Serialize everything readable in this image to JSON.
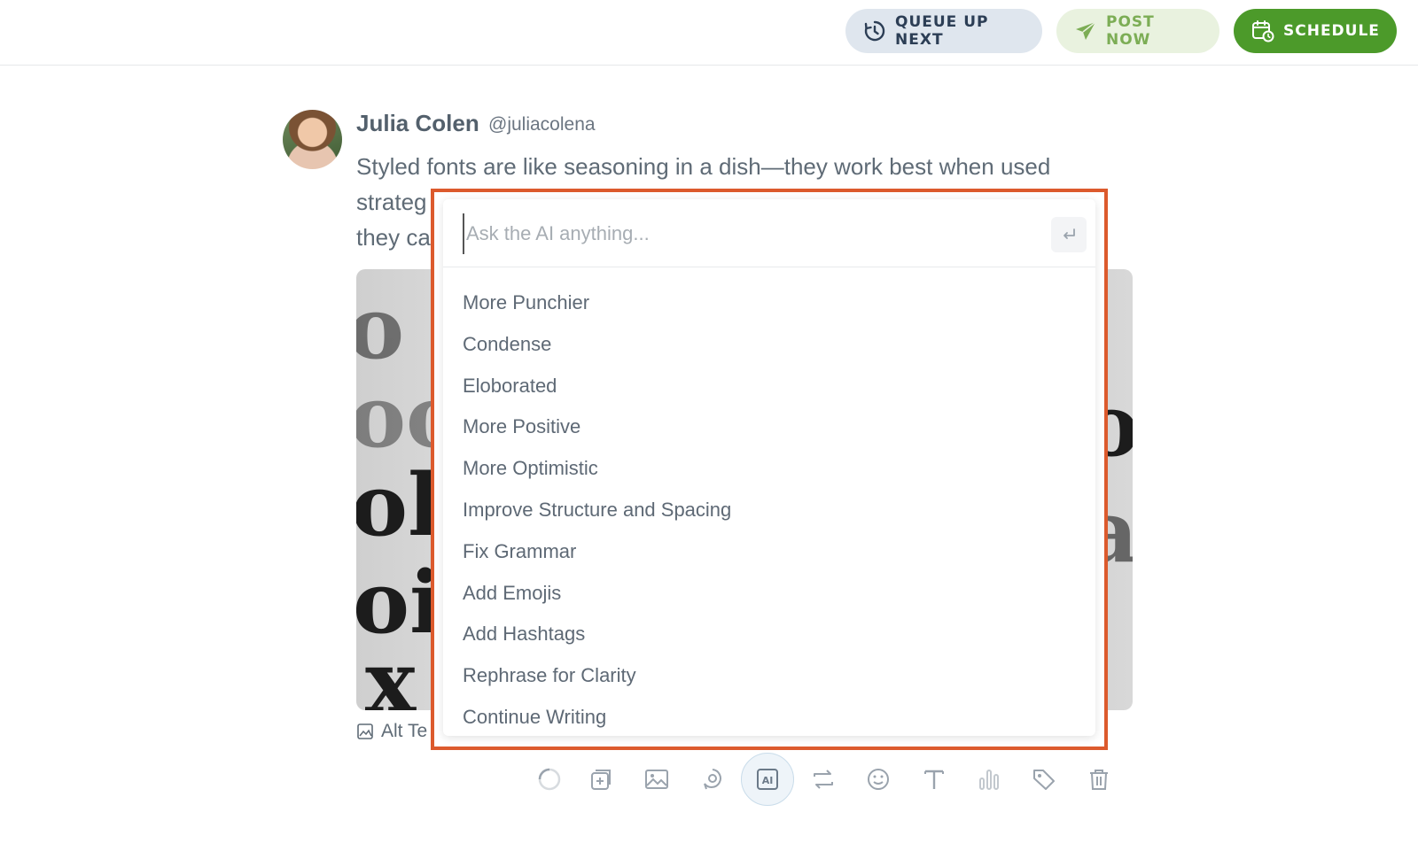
{
  "header": {
    "queue_label": "QUEUE UP NEXT",
    "post_label": "POST NOW",
    "schedule_label": "SCHEDULE"
  },
  "post": {
    "author_name": "Julia Colen",
    "author_handle": "@juliacolena",
    "text": "Styled fonts are like seasoning in a dish—they work best when used\nstrateg                                                                    ts,\nthey ca                                                                      e.",
    "alt_text_label": "Alt Te"
  },
  "ai_popup": {
    "placeholder": "Ask the AI anything...",
    "options": [
      "More Punchier",
      "Condense",
      "Eloborated",
      "More Positive",
      "More Optimistic",
      "Improve Structure and Spacing",
      "Fix Grammar",
      "Add Emojis",
      "Add Hashtags",
      "Rephrase for Clarity",
      "Continue Writing"
    ]
  },
  "toolbar": {
    "tools": [
      "loading-icon",
      "add-thread-icon",
      "image-icon",
      "gif-icon",
      "ai-icon",
      "repost-icon",
      "emoji-icon",
      "text-style-icon",
      "poll-icon",
      "tag-icon",
      "trash-icon"
    ],
    "ai_label": "AI"
  },
  "colors": {
    "schedule_green": "#4c9a2a",
    "highlight_frame": "#dc5a2d"
  }
}
